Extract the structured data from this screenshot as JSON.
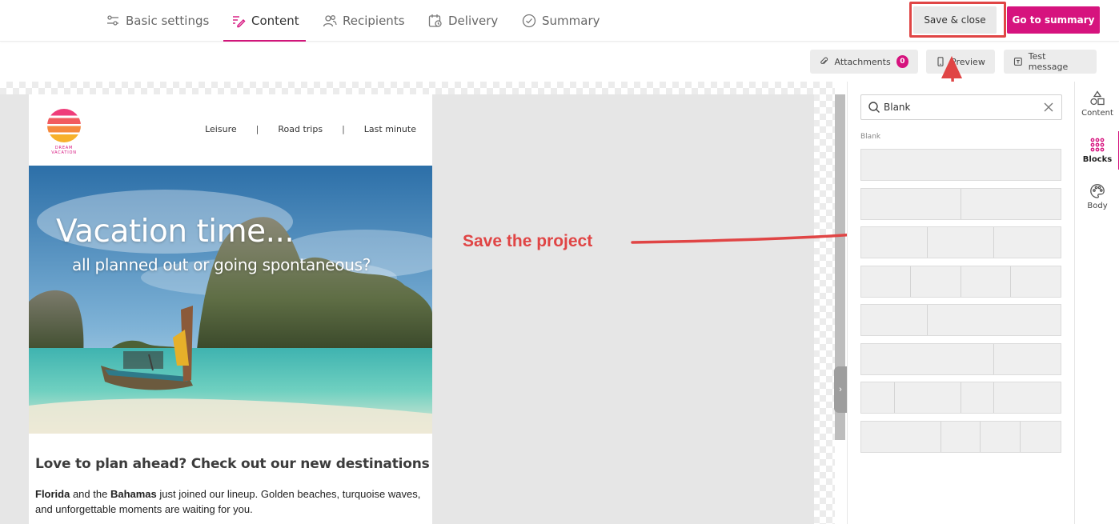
{
  "nav": {
    "tabs": [
      {
        "label": "Basic settings",
        "icon": "sliders-icon"
      },
      {
        "label": "Content",
        "icon": "edit-icon",
        "active": true
      },
      {
        "label": "Recipients",
        "icon": "users-icon"
      },
      {
        "label": "Delivery",
        "icon": "calendar-clock-icon"
      },
      {
        "label": "Summary",
        "icon": "check-circle-icon"
      }
    ],
    "save_label": "Save & close",
    "summary_label": "Go to summary",
    "accent_color": "#d6137e"
  },
  "toolbar": {
    "attachments_label": "Attachments",
    "attachments_count": "0",
    "preview_label": "Preview",
    "test_label": "Test message"
  },
  "email": {
    "logo_text": "DREAM VACATION",
    "nav": [
      "Leisure",
      "Road trips",
      "Last minute"
    ],
    "nav_separator": "|",
    "hero_title": "Vacation time...",
    "hero_subtitle": "all planned out or going spontaneous?",
    "heading": "Love to plan ahead? Check out our new destinations",
    "body_bold_1": "Florida",
    "body_text_1": " and the ",
    "body_bold_2": "Bahamas",
    "body_text_2": " just joined our lineup. Golden beaches, turquoise waves, and unforgettable moments are waiting for you."
  },
  "annotation": {
    "text": "Save the project",
    "color": "#e04545"
  },
  "panel": {
    "search_value": "Blank",
    "section_label": "Blank",
    "layouts": [
      [
        1
      ],
      [
        1,
        1
      ],
      [
        1,
        1,
        1
      ],
      [
        1,
        1,
        1,
        1
      ],
      [
        1,
        2
      ],
      [
        2,
        1
      ],
      [
        1,
        2,
        1,
        2
      ],
      [
        2,
        1,
        1,
        1
      ]
    ]
  },
  "rail": [
    {
      "label": "Content",
      "icon": "shapes-icon"
    },
    {
      "label": "Blocks",
      "icon": "grid-dots-icon",
      "active": true
    },
    {
      "label": "Body",
      "icon": "palette-icon"
    }
  ]
}
